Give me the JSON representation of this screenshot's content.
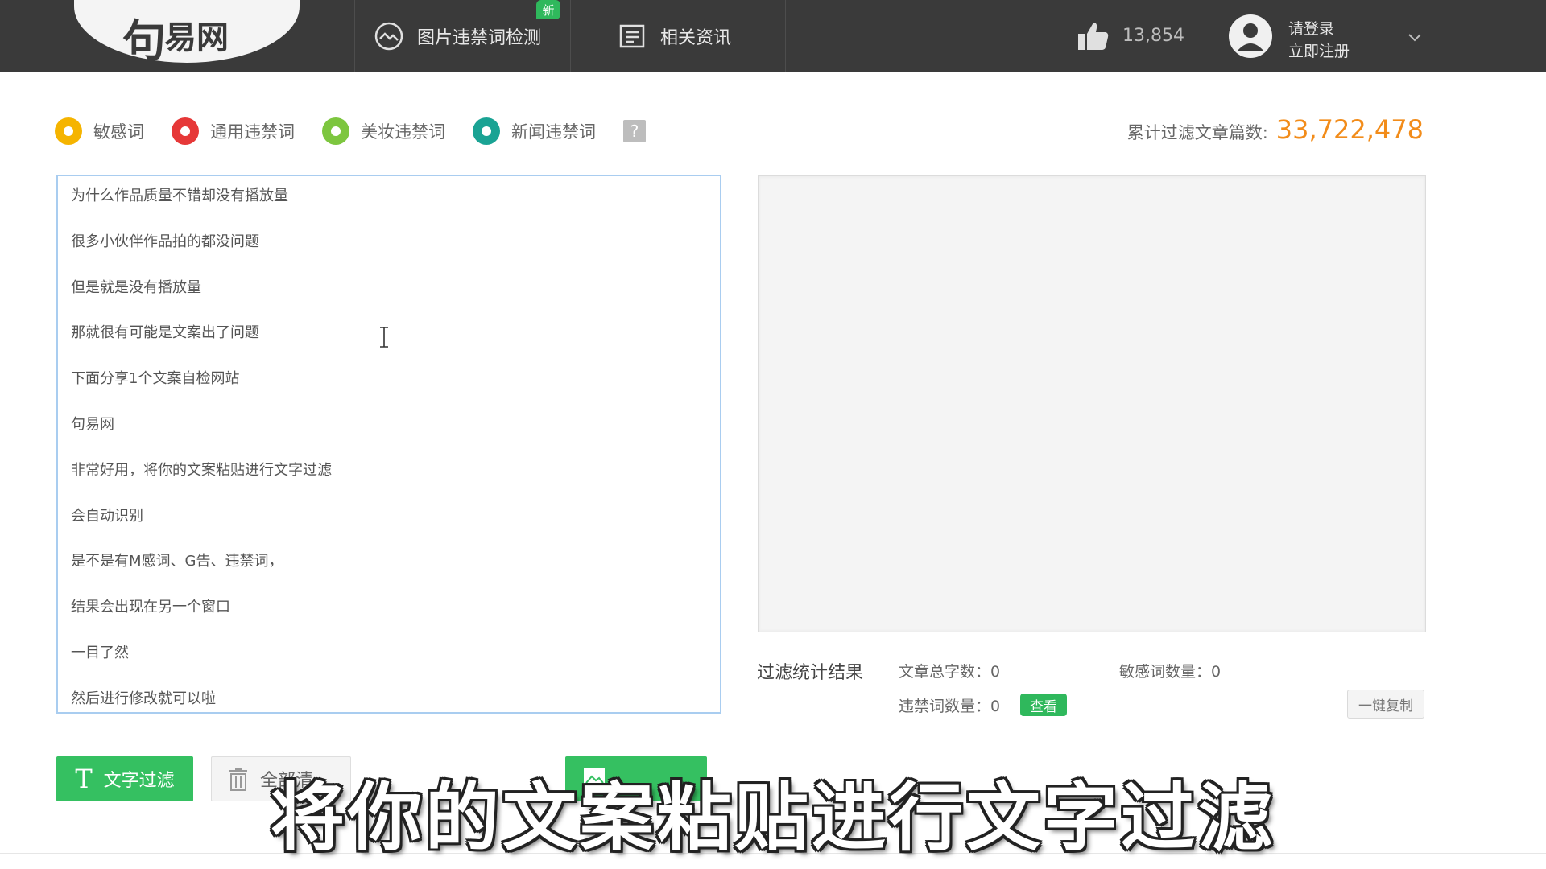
{
  "header": {
    "logo_mark": "句",
    "logo_text": "易网",
    "nav": [
      {
        "label": "图片违禁词检测",
        "badge": "新"
      },
      {
        "label": "相关资讯"
      }
    ],
    "like_count": "13,854",
    "login_label": "请登录",
    "register_label": "立即注册"
  },
  "legend": {
    "items": [
      {
        "label": "敏感词",
        "color": "#f5b400"
      },
      {
        "label": "通用违禁词",
        "color": "#e63838"
      },
      {
        "label": "美妆违禁词",
        "color": "#7dc63f"
      },
      {
        "label": "新闻违禁词",
        "color": "#1aa394"
      }
    ],
    "help": "?"
  },
  "total": {
    "label": "累计过滤文章篇数:",
    "value": "33,722,478"
  },
  "editor": {
    "lines": [
      "为什么作品质量不错却没有播放量",
      "很多小伙伴作品拍的都没问题",
      "但是就是没有播放量",
      "那就很有可能是文案出了问题",
      "下面分享1个文案自检网站",
      "句易网",
      "非常好用，将你的文案粘贴进行文字过滤",
      "会自动识别",
      "是不是有M感词、G告、违禁词，",
      "结果会出现在另一个窗口",
      "一目了然",
      "然后进行修改就可以啦"
    ]
  },
  "stats": {
    "title": "过滤统计结果",
    "total_chars": "文章总字数：0",
    "sensitive_count": "敏感词数量：0",
    "banned_count": "违禁词数量：0",
    "view_label": "查看",
    "copy_label": "一键复制"
  },
  "buttons": {
    "filter_label": "文字过滤",
    "filter_glyph": "T",
    "clear_label": "全部清"
  },
  "subtitle": "将你的文案粘贴进行文字过滤"
}
